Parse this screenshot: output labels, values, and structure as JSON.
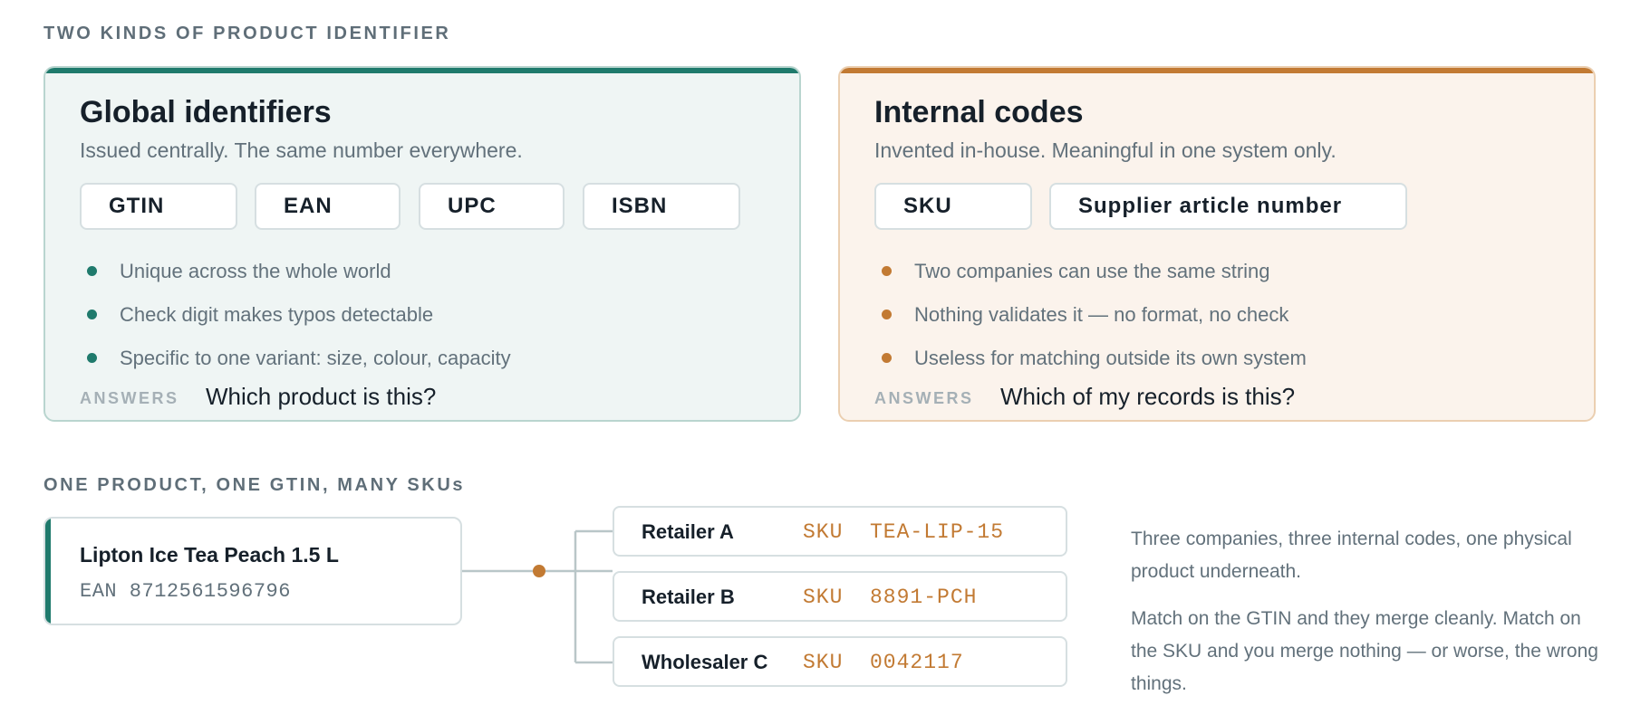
{
  "section1": {
    "label": "TWO KINDS OF PRODUCT IDENTIFIER"
  },
  "global": {
    "title": "Global identifiers",
    "subtitle": "Issued centrally. The same number everywhere.",
    "chips": [
      "GTIN",
      "EAN",
      "UPC",
      "ISBN"
    ],
    "bullets": [
      "Unique across the whole world",
      "Check digit makes typos detectable",
      "Specific to one variant: size, colour, capacity"
    ],
    "answers_label": "ANSWERS",
    "answers_text": "Which product is this?",
    "accent_color": "#1f7a6c"
  },
  "internal": {
    "title": "Internal codes",
    "subtitle": "Invented in-house. Meaningful in one system only.",
    "chips": [
      "SKU",
      "Supplier article number"
    ],
    "bullets": [
      "Two companies can use the same string",
      "Nothing validates it — no format, no check",
      "Useless for matching outside its own system"
    ],
    "answers_label": "ANSWERS",
    "answers_text": "Which of my records is this?",
    "accent_color": "#c27a33"
  },
  "section2": {
    "label": "ONE PRODUCT, ONE GTIN, MANY SKUs"
  },
  "product": {
    "name": "Lipton Ice Tea Peach 1.5 L",
    "ean": "EAN 8712561596796"
  },
  "retailers": [
    {
      "name": "Retailer A",
      "sku_label": "SKU",
      "code": "TEA-LIP-15"
    },
    {
      "name": "Retailer B",
      "sku_label": "SKU",
      "code": "8891-PCH"
    },
    {
      "name": "Wholesaler C",
      "sku_label": "SKU",
      "code": "0042117"
    }
  ],
  "notes": {
    "line1": "Three companies, three internal codes, one physical product underneath.",
    "line2": "Match on the GTIN and they merge cleanly. Match on the SKU and you merge nothing — or worse, the wrong things."
  }
}
